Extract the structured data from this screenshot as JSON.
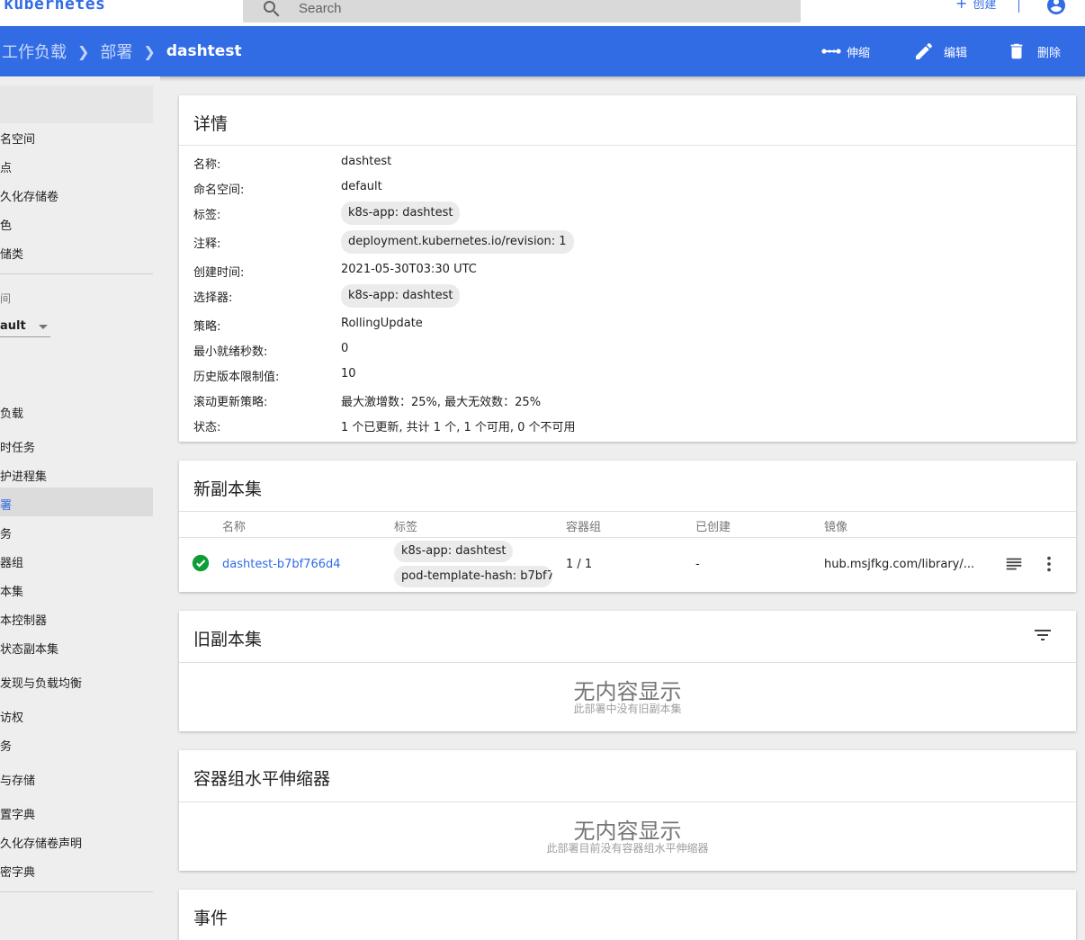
{
  "app": {
    "brand": "kubernetes"
  },
  "search": {
    "placeholder": "Search"
  },
  "topbar": {
    "create_label": "创建"
  },
  "breadcrumb": {
    "items": [
      "工作负载",
      "部署"
    ],
    "current": "dashtest"
  },
  "toolbar": {
    "scale_label": "伸缩",
    "edit_label": "编辑",
    "delete_label": "删除"
  },
  "sidebar": {
    "items_top": [
      "名称空间",
      "节点",
      "持久化存储卷",
      "角色",
      "存储类"
    ],
    "namespace_label": "名称空间",
    "namespace_value": "default",
    "items_workloads": [
      "工作负载",
      "定时任务",
      "守护进程集",
      "部署",
      "任务",
      "容器组",
      "副本集",
      "副本控制器",
      "有状态副本集"
    ],
    "items_bottom": [
      "服务发现与负载均衡",
      "服务",
      "配置与存储",
      "配置字典",
      "持久化存储卷声明",
      "保密字典"
    ],
    "visible": {
      "items_top": [
        "名空间",
        "点",
        "久化存储卷",
        "色",
        "储类"
      ],
      "namespace_label": "间",
      "namespace_value": "ault",
      "items_workloads": [
        "负载",
        "时任务",
        "护进程集",
        "署",
        "务",
        "器组",
        "本集",
        "本控制器",
        "状态副本集"
      ],
      "items_bottom": [
        "发现与负载均衡",
        "访权",
        "务",
        "与存储",
        "置字典",
        "久化存储卷声明",
        "密字典"
      ]
    }
  },
  "details": {
    "title": "详情",
    "rows": [
      {
        "key": "名称:",
        "value": "dashtest"
      },
      {
        "key": "命名空间:",
        "value": "default"
      },
      {
        "key": "标签:",
        "chip": "k8s-app: dashtest"
      },
      {
        "key": "注释:",
        "chip": "deployment.kubernetes.io/revision:  1"
      },
      {
        "key": "创建时间:",
        "value": "2021-05-30T03:30 UTC"
      },
      {
        "key": "选择器:",
        "chip": "k8s-app: dashtest"
      },
      {
        "key": "策略:",
        "value": "RollingUpdate"
      },
      {
        "key": "最小就绪秒数:",
        "value": "0"
      },
      {
        "key": "历史版本限制值:",
        "value": "10"
      },
      {
        "key": "滚动更新策略:",
        "value": "最大激增数：25%, 最大无效数：25%"
      },
      {
        "key": "状态:",
        "value": "1 个已更新, 共计 1 个, 1 个可用, 0 个不可用"
      }
    ]
  },
  "new_replicasets": {
    "title": "新副本集",
    "columns": [
      "名称",
      "标签",
      "容器组",
      "已创建",
      "镜像"
    ],
    "rows": [
      {
        "name": "dashtest-b7bf766d4",
        "labels": [
          "k8s-app: dashtest",
          "pod-template-hash: b7bf7..."
        ],
        "pods": "1 / 1",
        "created": "-",
        "image": "hub.msjfkg.com/library/...",
        "status": "ok"
      }
    ]
  },
  "old_replicasets": {
    "title": "旧副本集",
    "empty_title": "无内容显示",
    "empty_sub": "此部署中没有旧副本集"
  },
  "hpa": {
    "title": "容器组水平伸缩器",
    "empty_title": "无内容显示",
    "empty_sub": "此部署目前没有容器组水平伸缩器"
  },
  "events": {
    "title": "事件"
  },
  "colors": {
    "primary": "#326ce5",
    "success": "#0d9e37",
    "background": "#eeeeee"
  }
}
